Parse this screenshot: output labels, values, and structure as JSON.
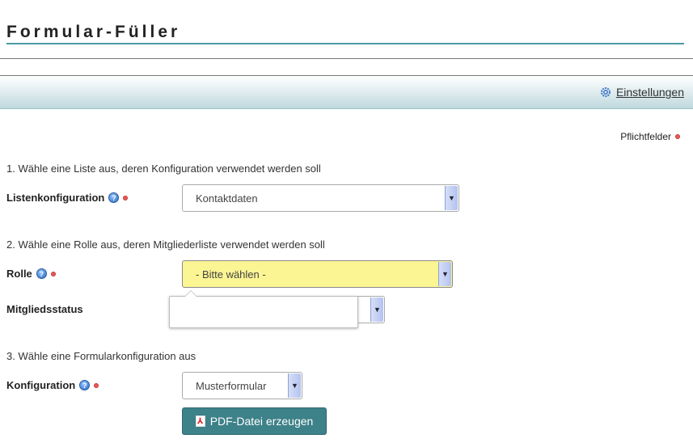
{
  "app": {
    "title": "Formular-Füller"
  },
  "navbar": {
    "settings_label": "Einstellungen",
    "settings_icon": "gear-icon"
  },
  "required_legend": {
    "label": "Pflichtfelder",
    "color": "#e35b5b"
  },
  "steps": {
    "step1": "1. Wähle eine Liste aus, deren Konfiguration verwendet werden soll",
    "step2": "2. Wähle eine Rolle aus, deren Mitgliederliste verwendet werden soll",
    "step3": "3. Wähle eine Formularkonfiguration aus"
  },
  "fields": {
    "listenkonfiguration": {
      "label": "Listenkonfiguration",
      "value": "Kontaktdaten",
      "required": true
    },
    "rolle": {
      "label": "Rolle",
      "value": "- Bitte wählen -",
      "required": true,
      "highlight_color": "#fbf594"
    },
    "mitgliedsstatus": {
      "label": "Mitgliedsstatus",
      "value": ""
    },
    "konfiguration": {
      "label": "Konfiguration",
      "value": "Musterformular",
      "required": true
    }
  },
  "actions": {
    "pdf_button": "PDF-Datei erzeugen",
    "pdf_icon": "pdf-icon",
    "button_color": "#3d8189"
  }
}
